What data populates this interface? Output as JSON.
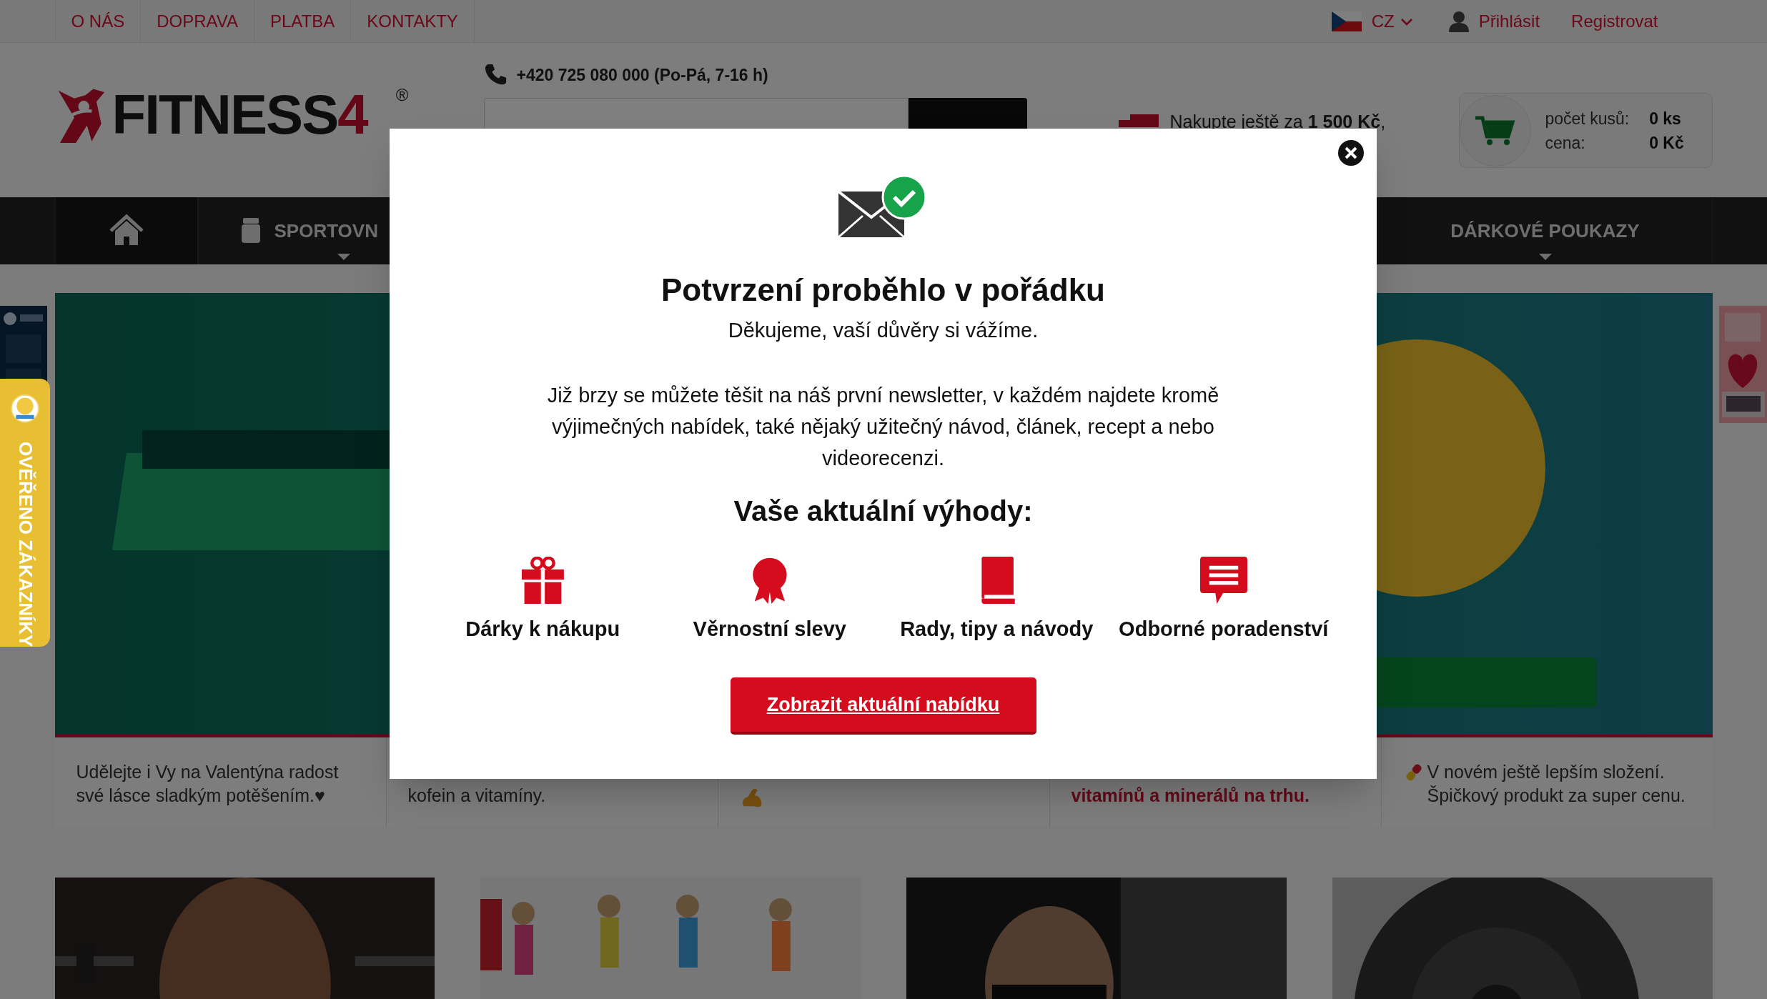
{
  "top_bar": {
    "links": [
      "O NÁS",
      "DOPRAVA",
      "PLATBA",
      "KONTAKTY"
    ],
    "language": "CZ",
    "login": "Přihlásit",
    "register": "Registrovat"
  },
  "header": {
    "logo": {
      "text": "FITNESS",
      "accent": "4",
      "mark": "®"
    },
    "phone": "+420 725 080 000 (Po-Pá, 7-16 h)",
    "shipping": "Nakupte ještě za **1 500 Kč**,",
    "cart": {
      "count_label": "počet kusů:",
      "count": "0 ks",
      "price_label": "cena:",
      "price": "0 Kč"
    }
  },
  "nav": [
    {
      "kind": "home"
    },
    {
      "kind": "category",
      "label": "SPORTOVN"
    },
    {
      "kind": "category",
      "label": "DÁRKOVÉ POUKAZY"
    }
  ],
  "side_tab": "OVĚŘENO ZÁKAZNÍKY",
  "captions": [
    {
      "kind": "text",
      "text": "Udělejte i Vy na Valentýna radost své lásce sladkým potěšením.♥",
      "emphasis": false
    },
    {
      "kind": "text",
      "text": "kofein a vitamíny.",
      "emphasis": false
    },
    {
      "kind": "arm"
    },
    {
      "kind": "text",
      "text": "vitamínů a minerálů na trhu.",
      "emphasis": true
    },
    {
      "kind": "pill",
      "text": "V novém ještě lepším složení. Špičkový produkt za super cenu.",
      "emphasis": false
    }
  ],
  "modal": {
    "title": "Potvrzení proběhlo v pořádku",
    "subtitle": "Děkujeme, vaší důvěry si vážíme.",
    "body": "Již brzy se můžete těšit na náš první newsletter, v každém najdete kromě výjimečných nabídek, také nějaký užitečný návod, článek, recept a nebo videorecenzi.",
    "benefits_title": "Vaše aktuální výhody:",
    "benefits": [
      {
        "kind": "gift",
        "label": "Dárky k nákupu"
      },
      {
        "kind": "rosette",
        "label": "Věrnostní slevy"
      },
      {
        "kind": "book",
        "label": "Rady, tipy a návody"
      },
      {
        "kind": "chat",
        "label": "Odborné poradenství"
      }
    ],
    "button": "Zobrazit aktuální nabídku"
  }
}
